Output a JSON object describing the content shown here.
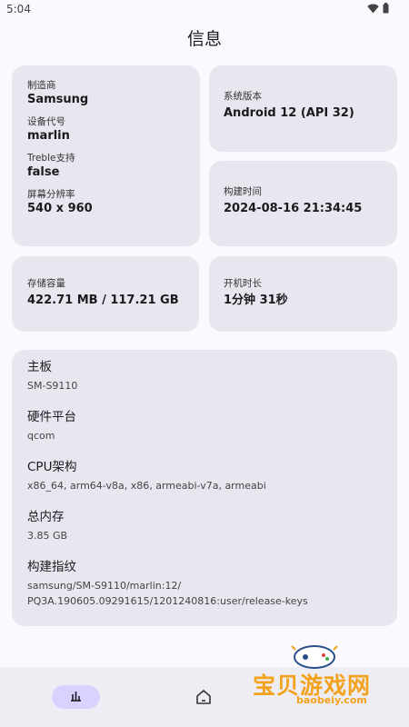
{
  "status": {
    "time": "5:04"
  },
  "title": "信息",
  "device": {
    "manufacturer_label": "制造商",
    "manufacturer": "Samsung",
    "codename_label": "设备代号",
    "codename": "marlin",
    "treble_label": "Treble支持",
    "treble": "false",
    "resolution_label": "屏幕分辨率",
    "resolution": "540 x 960"
  },
  "android": {
    "label": "系统版本",
    "value": "Android 12 (API 32)"
  },
  "build_time": {
    "label": "构建时间",
    "value": "2024-08-16 21:34:45"
  },
  "storage": {
    "label": "存储容量",
    "value": "422.71 MB / 117.21 GB"
  },
  "uptime": {
    "label": "开机时长",
    "value": "1分钟 31秒"
  },
  "details": [
    {
      "label": "主板",
      "value": "SM-S9110"
    },
    {
      "label": "硬件平台",
      "value": "qcom"
    },
    {
      "label": "CPU架构",
      "value": "x86_64, arm64-v8a, x86, armeabi-v7a, armeabi"
    },
    {
      "label": "总内存",
      "value": "3.85 GB"
    },
    {
      "label": "构建指纹",
      "value": "samsung/SM-S9110/marlin:12/\nPQ3A.190605.09291615/1201240816:user/release-keys"
    }
  ],
  "watermark": {
    "text": "宝贝游戏网",
    "sub": "baobeiy.com"
  },
  "colors": {
    "card": "#e8e6ef",
    "nav_active": "#d9d2ff",
    "watermark": "#f2a21c"
  }
}
